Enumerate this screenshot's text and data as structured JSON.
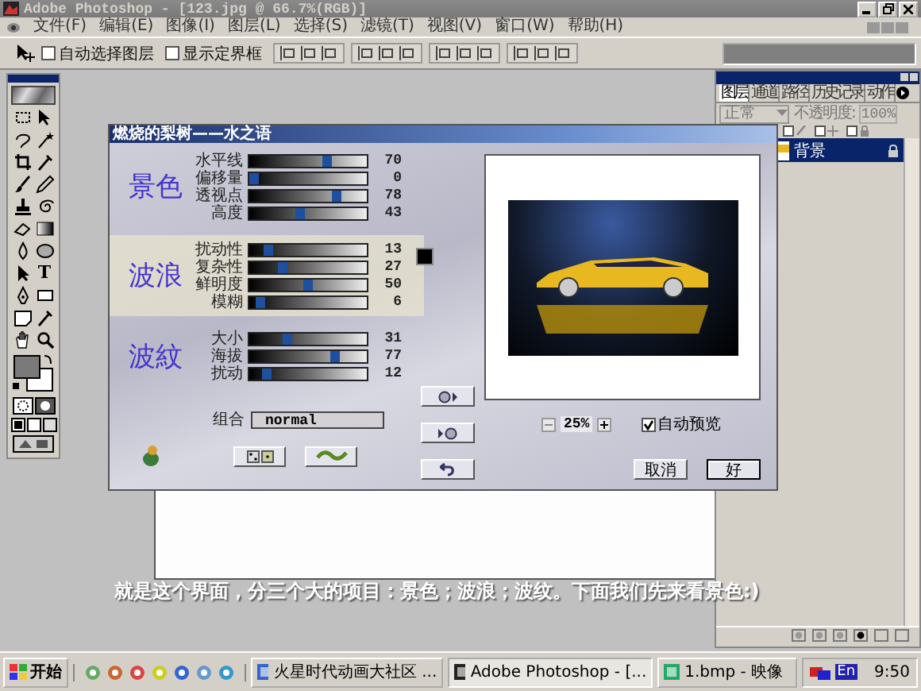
{
  "window": {
    "title": "Adobe Photoshop - [123.jpg @ 66.7%(RGB)]"
  },
  "menu": [
    "文件(F)",
    "编辑(E)",
    "图像(I)",
    "图层(L)",
    "选择(S)",
    "滤镜(T)",
    "视图(V)",
    "窗口(W)",
    "帮助(H)"
  ],
  "options_bar": {
    "checkboxes": [
      {
        "label": "自动选择图层",
        "checked": false
      },
      {
        "label": "显示定界框",
        "checked": false
      }
    ]
  },
  "toolbox": {
    "type_tool": "T"
  },
  "dialog": {
    "title": "燃烧的梨树——水之语",
    "sections": [
      {
        "name": "景色",
        "sliders": [
          {
            "label": "水平线",
            "level": 0.68,
            "reading": "70"
          },
          {
            "label": "偏移量",
            "level": 0.0,
            "reading": "0"
          },
          {
            "label": "透视点",
            "level": 0.76,
            "reading": "78"
          },
          {
            "label": "高度",
            "level": 0.42,
            "reading": "43"
          }
        ]
      },
      {
        "name": "波浪",
        "sliders": [
          {
            "label": "扰动性",
            "level": 0.13,
            "reading": "13"
          },
          {
            "label": "复杂性",
            "level": 0.27,
            "reading": "27"
          },
          {
            "label": "鲜明度",
            "level": 0.5,
            "reading": "50"
          },
          {
            "label": "模糊",
            "level": 0.06,
            "reading": "6"
          }
        ]
      },
      {
        "name": "波紋",
        "sliders": [
          {
            "label": "大小",
            "level": 0.31,
            "reading": "31"
          },
          {
            "label": "海拔",
            "level": 0.75,
            "reading": "77"
          },
          {
            "label": "扰动",
            "level": 0.12,
            "reading": "12"
          }
        ]
      }
    ],
    "blend": {
      "label": "组合",
      "value": "normal"
    },
    "zoom": "25%",
    "auto_preview": {
      "label": "自动预览",
      "checked": true
    },
    "buttons": [
      "取消",
      "好"
    ]
  },
  "layers_panel": {
    "tabs": [
      {
        "label": "图层",
        "selected": true
      },
      {
        "label": "通道",
        "selected": false
      },
      {
        "label": "路径",
        "selected": false
      },
      {
        "label": "历史记录",
        "selected": false
      },
      {
        "label": "动作",
        "selected": false
      }
    ],
    "blend_mode": "正常",
    "opacity_label": "不透明度:",
    "opacity": "100%",
    "locks": [
      {
        "checked": false
      },
      {
        "checked": false
      },
      {
        "checked": false
      }
    ],
    "layers": [
      {
        "name": "背景",
        "selected": true
      }
    ]
  },
  "caption": "就是这个界面，分三个大的项目：景色；波浪；波纹。下面我们先来看景色:)",
  "taskbar": {
    "start": "开始",
    "tasks": [
      {
        "label": "火星时代动画大社区 ...",
        "selected": false
      },
      {
        "label": "Adobe Photoshop - [...",
        "selected": true
      },
      {
        "label": "1.bmp - 映像",
        "selected": false
      }
    ],
    "language": "En",
    "clock": "9:50"
  }
}
